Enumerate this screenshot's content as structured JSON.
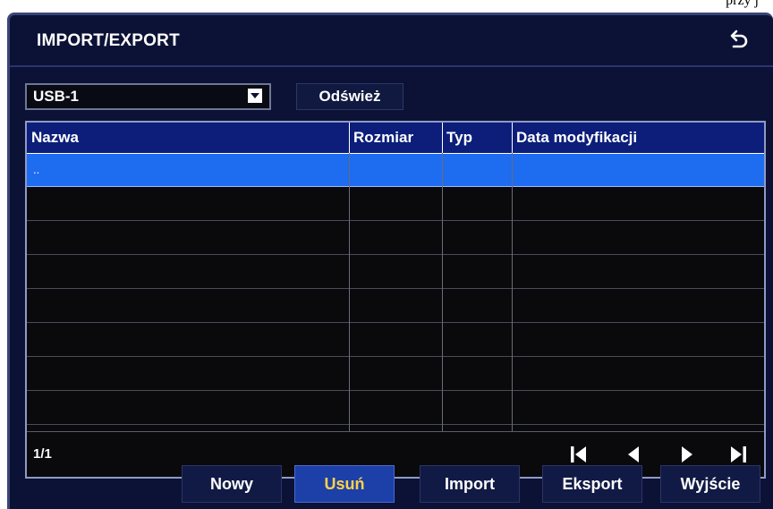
{
  "caption_fragment": "przy j",
  "window": {
    "title": "IMPORT/EXPORT",
    "back_icon": "undo-arrow-icon"
  },
  "toolbar": {
    "device_value": "USB-1",
    "refresh_label": "Odśwież"
  },
  "table": {
    "columns": [
      "Nazwa",
      "Rozmiar",
      "Typ",
      "Data modyfikacji"
    ],
    "rows": [
      {
        "name": "..",
        "size": "",
        "type": "",
        "date": "",
        "selected": true
      },
      {
        "name": "",
        "size": "",
        "type": "",
        "date": ""
      },
      {
        "name": "",
        "size": "",
        "type": "",
        "date": ""
      },
      {
        "name": "",
        "size": "",
        "type": "",
        "date": ""
      },
      {
        "name": "",
        "size": "",
        "type": "",
        "date": ""
      },
      {
        "name": "",
        "size": "",
        "type": "",
        "date": ""
      },
      {
        "name": "",
        "size": "",
        "type": "",
        "date": ""
      },
      {
        "name": "",
        "size": "",
        "type": "",
        "date": ""
      }
    ],
    "page": "1/1",
    "pager_icons": [
      "first-page-icon",
      "prev-page-icon",
      "next-page-icon",
      "last-page-icon"
    ]
  },
  "buttons": {
    "new": "Nowy",
    "delete": "Usuń",
    "import": "Import",
    "export": "Eksport",
    "exit": "Wyjście"
  },
  "colors": {
    "window_bg": "#0c1236",
    "selected_row": "#1e6cf0",
    "header_bg": "#0c1e7a",
    "active_button_text": "#ffd24a"
  }
}
